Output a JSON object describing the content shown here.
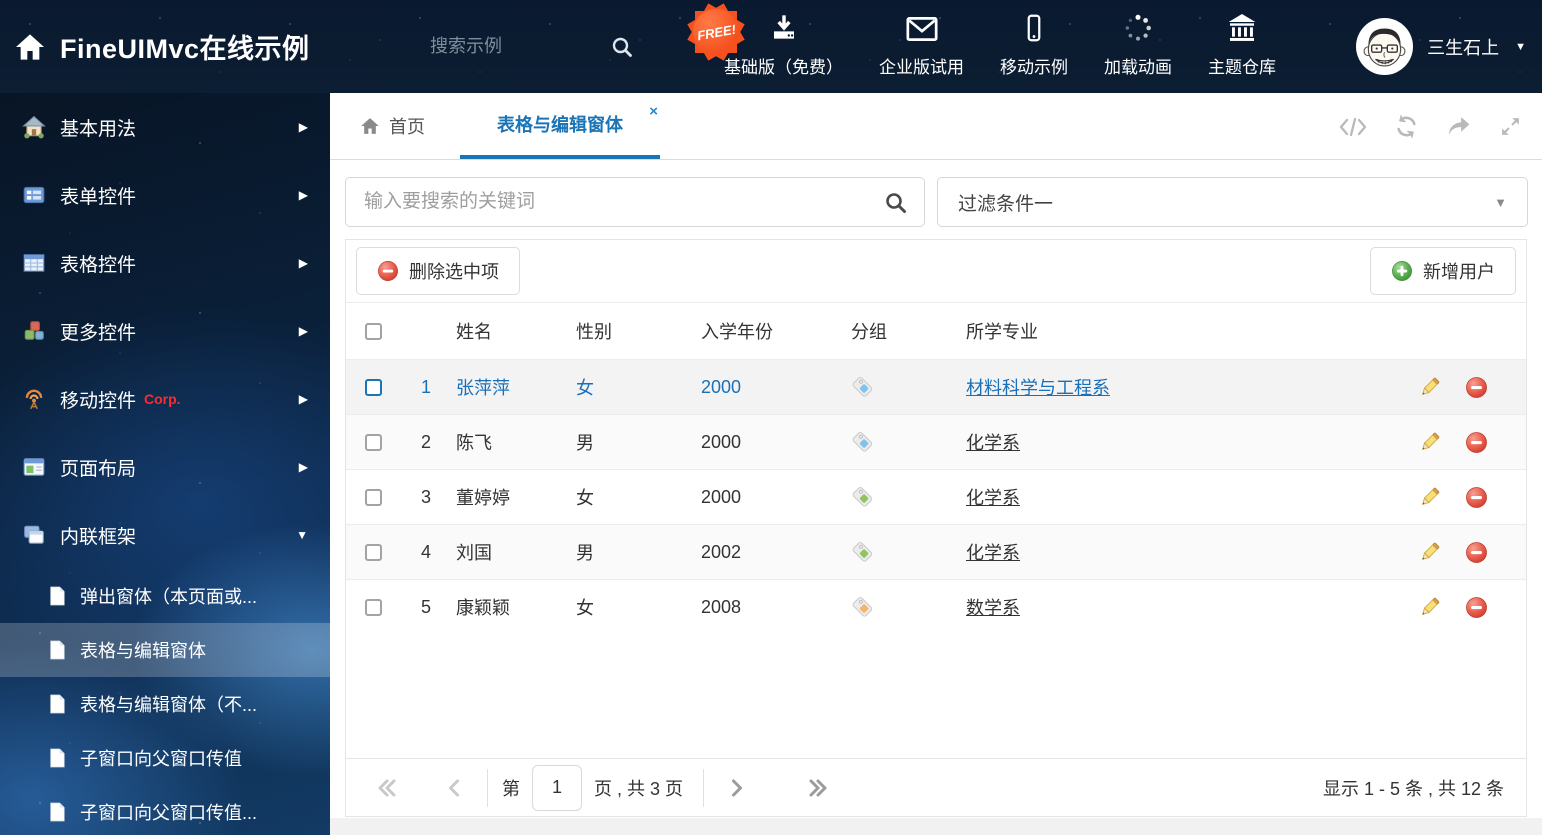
{
  "header": {
    "title": "FineUIMvc在线示例",
    "search_placeholder": "搜索示例",
    "free_badge": "FREE!",
    "nav_items": [
      {
        "label": "基础版（免费）",
        "icon": "download-icon"
      },
      {
        "label": "企业版试用",
        "icon": "envelope-icon"
      },
      {
        "label": "移动示例",
        "icon": "mobile-icon"
      },
      {
        "label": "加载动画",
        "icon": "spinner-icon"
      },
      {
        "label": "主题仓库",
        "icon": "bank-icon"
      }
    ],
    "user_name": "三生石上"
  },
  "sidebar": {
    "items": [
      {
        "label": "基本用法",
        "icon": "home-colored-icon",
        "arrow": "right"
      },
      {
        "label": "表单控件",
        "icon": "form-icon",
        "arrow": "right"
      },
      {
        "label": "表格控件",
        "icon": "table-icon",
        "arrow": "right"
      },
      {
        "label": "更多控件",
        "icon": "cubes-icon",
        "arrow": "right"
      },
      {
        "label": "移动控件",
        "badge": "Corp.",
        "icon": "antenna-icon",
        "arrow": "right"
      },
      {
        "label": "页面布局",
        "icon": "layout-icon",
        "arrow": "right"
      },
      {
        "label": "内联框架",
        "icon": "frames-icon",
        "arrow": "down"
      }
    ],
    "subitems": [
      {
        "label": "弹出窗体（本页面或...",
        "active": false
      },
      {
        "label": "表格与编辑窗体",
        "active": true
      },
      {
        "label": "表格与编辑窗体（不...",
        "active": false
      },
      {
        "label": "子窗口向父窗口传值",
        "active": false
      },
      {
        "label": "子窗口向父窗口传值...",
        "active": false
      }
    ]
  },
  "tabs": {
    "home_label": "首页",
    "active_label": "表格与编辑窗体"
  },
  "filter_bar": {
    "search_placeholder": "输入要搜索的关键词",
    "filter_value": "过滤条件一"
  },
  "actions": {
    "delete_label": "删除选中项",
    "add_label": "新增用户"
  },
  "table": {
    "columns": [
      "姓名",
      "性别",
      "入学年份",
      "分组",
      "所学专业"
    ],
    "rows": [
      {
        "num": "1",
        "name": "张萍萍",
        "gender": "女",
        "year": "2000",
        "tag_color": "#7fc2ee",
        "major": "材料科学与工程系",
        "selected": true
      },
      {
        "num": "2",
        "name": "陈飞",
        "gender": "男",
        "year": "2000",
        "tag_color": "#7fc2ee",
        "major": "化学系",
        "selected": false
      },
      {
        "num": "3",
        "name": "董婷婷",
        "gender": "女",
        "year": "2000",
        "tag_color": "#8fc460",
        "major": "化学系",
        "selected": false
      },
      {
        "num": "4",
        "name": "刘国",
        "gender": "男",
        "year": "2002",
        "tag_color": "#8fc460",
        "major": "化学系",
        "selected": false
      },
      {
        "num": "5",
        "name": "康颖颖",
        "gender": "女",
        "year": "2008",
        "tag_color": "#f5b36c",
        "major": "数学系",
        "selected": false
      }
    ]
  },
  "pagination": {
    "page_label_prefix": "第",
    "page_value": "1",
    "page_label_suffix": "页 , 共 3 页",
    "summary": "显示 1 - 5 条 , 共 12 条"
  },
  "glyphs": {
    "close": "×",
    "caret_down": "▼",
    "arrow_right": "▶"
  },
  "colors": {
    "accent_blue": "#1b74b5",
    "selected_text": "#1a70b8",
    "delete_red": "#e25849",
    "add_green": "#55b152",
    "free_orange": "#f4511e"
  }
}
